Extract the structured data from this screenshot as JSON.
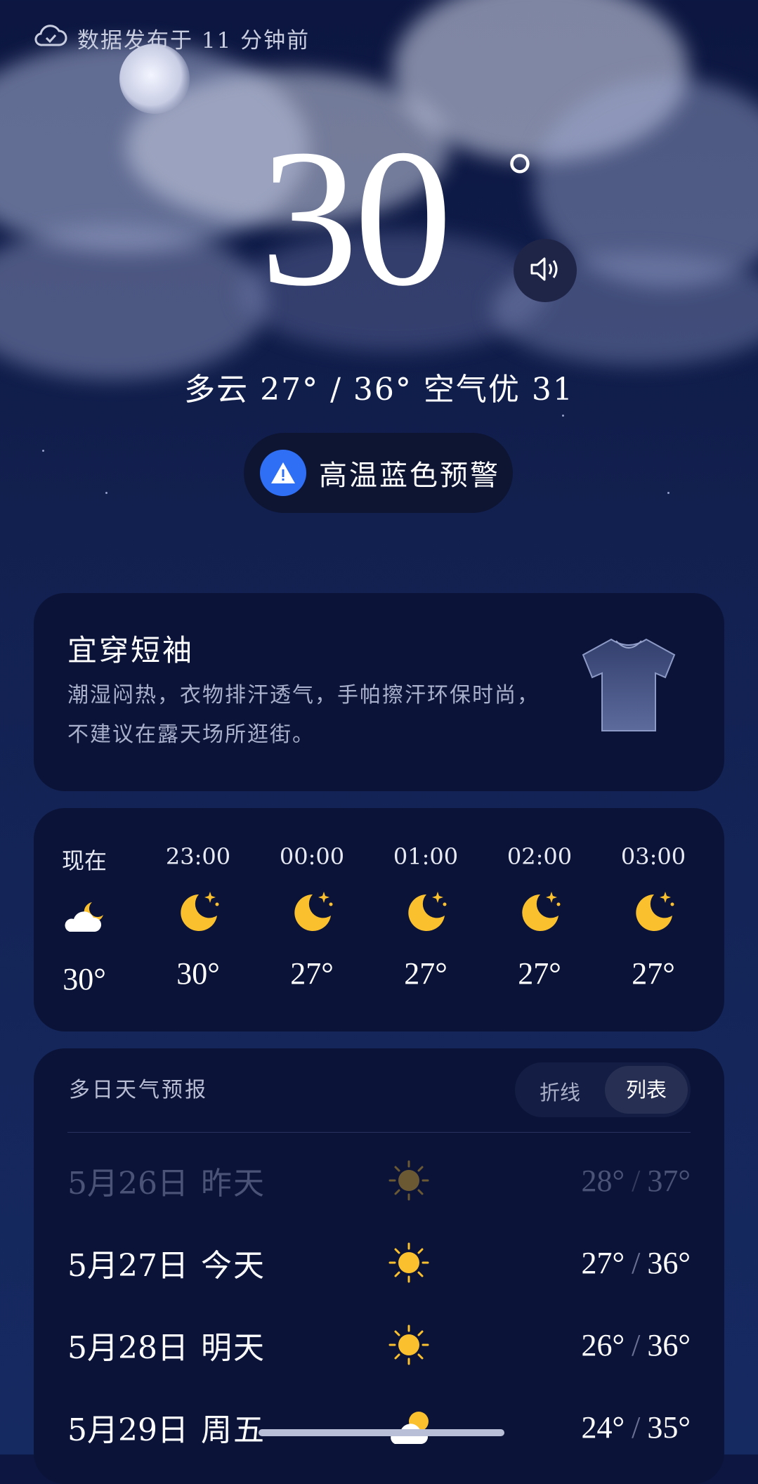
{
  "header": {
    "published": "数据发布于 11 分钟前"
  },
  "current": {
    "temp": "30",
    "deg": "°",
    "summary": "多云  27° / 36°  空气优 31",
    "alert": "高温蓝色预警"
  },
  "clothing": {
    "title": "宜穿短袖",
    "desc": "潮湿闷热，衣物排汗透气，手帕擦汗环保时尚，不建议在露天场所逛街。"
  },
  "hourly": [
    {
      "time": "现在",
      "icon": "cloudy-night-icon",
      "temp": "30°"
    },
    {
      "time": "23:00",
      "icon": "moon-icon",
      "temp": "30°"
    },
    {
      "time": "00:00",
      "icon": "moon-icon",
      "temp": "27°"
    },
    {
      "time": "01:00",
      "icon": "moon-icon",
      "temp": "27°"
    },
    {
      "time": "02:00",
      "icon": "moon-icon",
      "temp": "27°"
    },
    {
      "time": "03:00",
      "icon": "moon-icon",
      "temp": "27°"
    }
  ],
  "forecast": {
    "title": "多日天气预报",
    "toggle": {
      "line": "折线",
      "list": "列表"
    },
    "days": [
      {
        "date": "5月26日",
        "name": "昨天",
        "icon": "sun-icon",
        "low": "28°",
        "high": "37°"
      },
      {
        "date": "5月27日",
        "name": "今天",
        "icon": "sun-icon",
        "low": "27°",
        "high": "36°"
      },
      {
        "date": "5月28日",
        "name": "明天",
        "icon": "sun-icon",
        "low": "26°",
        "high": "36°"
      },
      {
        "date": "5月29日",
        "name": "周五",
        "icon": "partly-cloudy-icon",
        "low": "24°",
        "high": "35°"
      }
    ],
    "separator": "/"
  },
  "colors": {
    "accent": "#2f6ff5",
    "sun": "#fbc02d",
    "card": "#0b1438"
  }
}
